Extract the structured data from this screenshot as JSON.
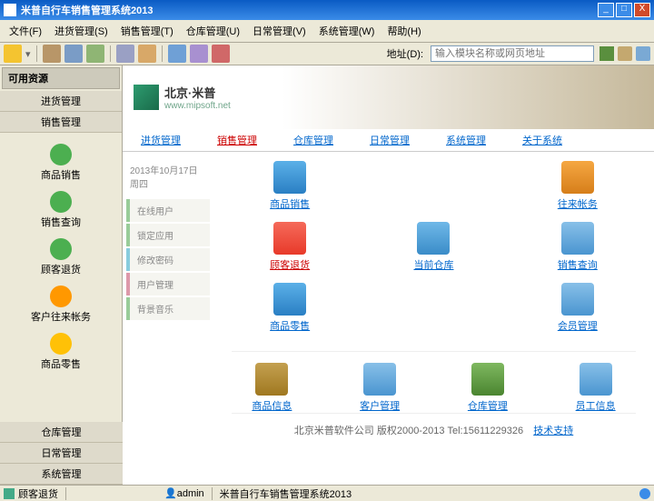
{
  "window": {
    "title": "米普自行车销售管理系统2013",
    "min": "_",
    "max": "□",
    "close": "X"
  },
  "menu": {
    "file": "文件(F)",
    "purchase": "进货管理(S)",
    "sales": "销售管理(T)",
    "warehouse": "仓库管理(U)",
    "daily": "日常管理(V)",
    "system": "系统管理(W)",
    "help": "帮助(H)"
  },
  "toolbar": {
    "addr_label": "地址(D):",
    "addr_placeholder": "输入模块名称或网页地址"
  },
  "sidebar": {
    "title": "可用资源",
    "sections": {
      "purchase": "进货管理",
      "sales": "销售管理",
      "warehouse": "仓库管理",
      "daily": "日常管理",
      "system": "系统管理"
    },
    "items": {
      "product_sales": "商品销售",
      "sales_query": "销售查询",
      "customer_return": "顾客退货",
      "customer_account": "客户往来帐务",
      "retail": "商品零售"
    }
  },
  "banner": {
    "brand_cn": "北京·米普",
    "brand_url": "www.mipsoft.net"
  },
  "nav": {
    "purchase": "进货管理",
    "sales": "销售管理",
    "warehouse": "仓库管理",
    "daily": "日常管理",
    "system": "系统管理",
    "about": "关于系统"
  },
  "side_menu": {
    "date": "2013年10月17日 周四",
    "items": [
      "在线用户",
      "锁定应用",
      "修改密码",
      "用户管理",
      "背景音乐"
    ]
  },
  "grid": {
    "r1c1": "商品销售",
    "r1c3": "往来帐务",
    "r2c1": "顾客退货",
    "r2c2": "当前仓库",
    "r2c3": "销售查询",
    "r3c1": "商品零售",
    "r3c3": "会员管理",
    "r4c1": "商品信息",
    "r4c2": "客户管理",
    "r4c3": "仓库管理",
    "r4c4": "员工信息"
  },
  "footer": {
    "company": "北京米普软件公司  版权2000-2013  Tel:15611229326",
    "support": "技术支持"
  },
  "status": {
    "left": "顾客退货",
    "user": "admin",
    "app": "米普自行车销售管理系统2013"
  },
  "colors": {
    "ic_green": "#4caf50",
    "ic_blue": "#2196f3",
    "ic_orange": "#ff9800",
    "ic_teal": "#009688",
    "ic_purple": "#9c27b0",
    "ic_red": "#f44336"
  }
}
